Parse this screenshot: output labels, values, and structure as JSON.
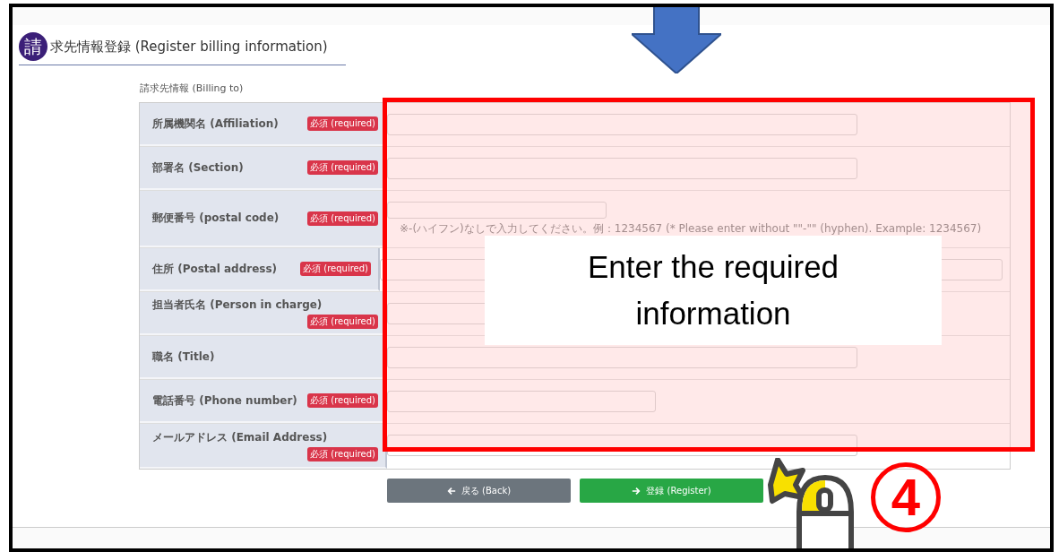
{
  "page": {
    "title_icon": "請",
    "title": "求先情報登録 (Register billing information)"
  },
  "section": {
    "label": "請求先情報 (Billing to)"
  },
  "fields": [
    {
      "label": "所属機関名 (Affiliation)",
      "badge": "必須 (required)"
    },
    {
      "label": "部署名 (Section)",
      "badge": "必須 (required)"
    },
    {
      "label": "郵便番号 (postal code)",
      "badge": "必須 (required)",
      "hint": "※-(ハイフン)なしで入力してください。例：1234567 (* Please enter without \"\"-\"\" (hyphen). Example: 1234567)"
    },
    {
      "label": "住所 (Postal address)",
      "badge": "必須 (required)"
    },
    {
      "label": "担当者氏名 (Person in charge)",
      "badge": "必須 (required)"
    },
    {
      "label": "職名 (Title)"
    },
    {
      "label": "電話番号 (Phone number)",
      "badge": "必須 (required)"
    },
    {
      "label": "メールアドレス (Email Address)",
      "badge": "必須 (required)"
    }
  ],
  "buttons": [
    {
      "kind": "back",
      "label": "戻る (Back)"
    },
    {
      "kind": "register",
      "label": "登録 (Register)"
    }
  ],
  "annotation": {
    "callout": "Enter the required information",
    "step": "4"
  }
}
